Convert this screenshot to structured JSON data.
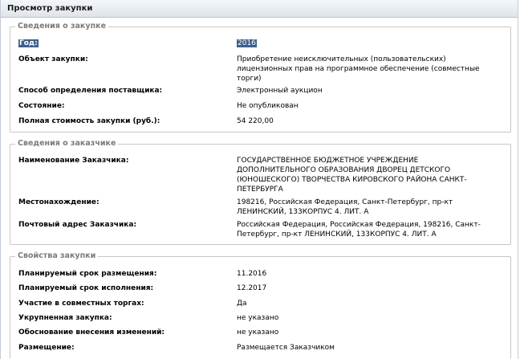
{
  "window": {
    "title": "Просмотр закупки"
  },
  "purchase_info": {
    "legend": "Сведения о закупке",
    "rows": [
      {
        "label": "Год:",
        "value": "2016"
      },
      {
        "label": "Объект закупки:",
        "value": "Приобретение неисключительных (пользовательских) лицензионных прав на программное обеспечение (совместные торги)"
      },
      {
        "label": "Способ определения поставщика:",
        "value": "Электронный аукцион"
      },
      {
        "label": "Состояние:",
        "value": "Не опубликован"
      },
      {
        "label": "Полная стоимость закупки (руб.):",
        "value": "54 220,00"
      }
    ]
  },
  "customer_info": {
    "legend": "Сведения о заказчике",
    "rows": [
      {
        "label": "Наименование Заказчика:",
        "value": "ГОСУДАРСТВЕННОЕ БЮДЖЕТНОЕ УЧРЕЖДЕНИЕ ДОПОЛНИТЕЛЬНОГО ОБРАЗОВАНИЯ ДВОРЕЦ ДЕТСКОГО (ЮНОШЕСКОГО) ТВОРЧЕСТВА КИРОВСКОГО РАЙОНА САНКТ-ПЕТЕРБУРГА"
      },
      {
        "label": "Местонахождение:",
        "value": "198216, Российская Федерация, Санкт-Петербург, пр-кт ЛЕНИНСКИЙ, 133КОРПУС 4. ЛИТ. А"
      },
      {
        "label": "Почтовый адрес Заказчика:",
        "value": "Российская Федерация, Российская Федерация, 198216, Санкт-Петербург, пр-кт ЛЕНИНСКИЙ, 133КОРПУС 4. ЛИТ. А"
      }
    ]
  },
  "purchase_props": {
    "legend": "Свойства закупки",
    "rows": [
      {
        "label": "Планируемый срок размещения:",
        "value": "11.2016"
      },
      {
        "label": "Планируемый срок исполнения:",
        "value": "12.2017"
      },
      {
        "label": "Участие в совместных торгах:",
        "value": "Да"
      },
      {
        "label": "Укрупненная закупка:",
        "value": "не указано"
      },
      {
        "label": "Обоснование внесения изменений:",
        "value": "не указано"
      },
      {
        "label": "Размещение:",
        "value": "Размещается Заказчиком"
      }
    ]
  }
}
